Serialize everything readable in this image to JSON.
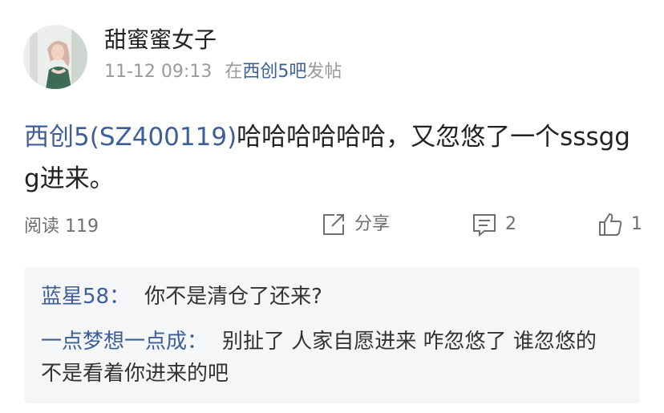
{
  "post": {
    "author": "甜蜜蜜女子",
    "time": "11-12 09:13",
    "board_prefix": "在",
    "board": "西创5吧",
    "board_suffix": "发帖",
    "stock_tag": "西创5(SZ400119)",
    "text": "哈哈哈哈哈哈，又忽悠了一个sssggg进来。"
  },
  "actions": {
    "reads_label": "阅读",
    "reads_count": "119",
    "share_label": "分享",
    "comment_count": "2",
    "like_count": "1"
  },
  "replies": [
    {
      "name": "蓝星58",
      "colon": "：",
      "text": "你不是清仓了还来?"
    },
    {
      "name": "一点梦想一点成",
      "colon": "：",
      "text": "别扯了 人家自愿进来 咋忽悠了 谁忽悠的 不是看着你进来的吧"
    }
  ],
  "colors": {
    "link": "#3d5e98",
    "meta": "#9a9a9a",
    "panel_bg": "#f5f6f8"
  }
}
